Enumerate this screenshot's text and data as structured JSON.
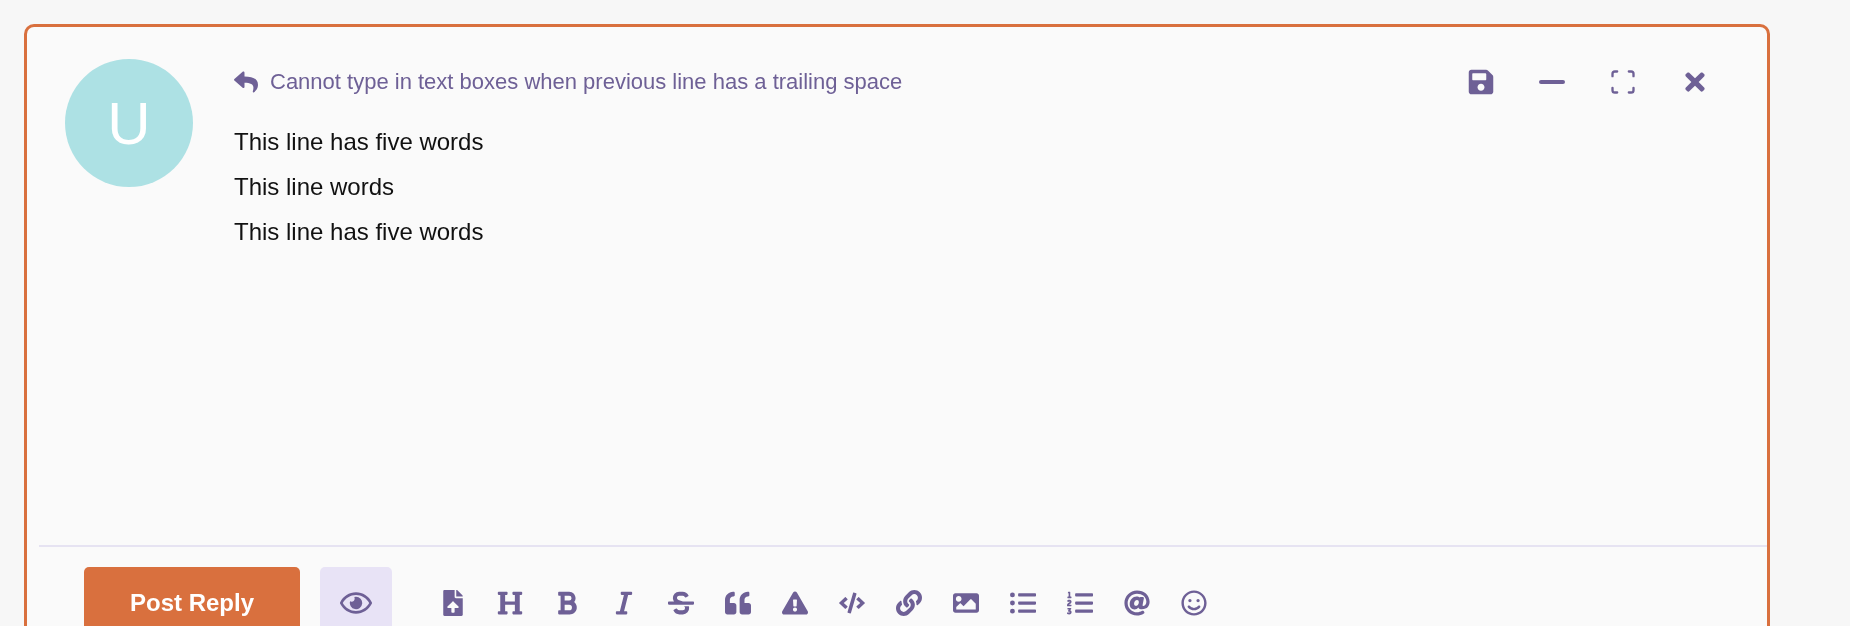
{
  "composer": {
    "reply_title": "Cannot type in text boxes when previous line has a trailing space",
    "avatar_letter": "U",
    "editor_lines": [
      "This line has five words",
      "This line words",
      "This line has five words"
    ],
    "submit_button": "Post Reply"
  }
}
